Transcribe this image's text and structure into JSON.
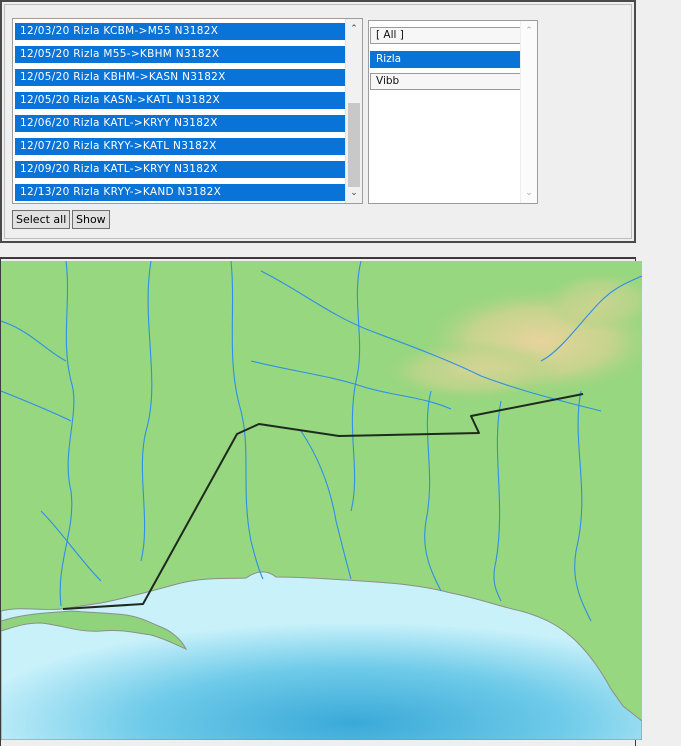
{
  "flights": {
    "rows": [
      "12/03/20 Rizla KCBM->M55 N3182X",
      "12/05/20 Rizla M55->KBHM N3182X",
      "12/05/20 Rizla KBHM->KASN N3182X",
      "12/05/20 Rizla KASN->KATL N3182X",
      "12/06/20 Rizla KATL->KRYY N3182X",
      "12/07/20 Rizla KRYY->KATL N3182X",
      "12/09/20 Rizla KATL->KRYY N3182X",
      "12/13/20 Rizla KRYY->KAND N3182X"
    ],
    "scroll_up_icon": "chevron-up-icon",
    "scroll_down_icon": "chevron-down-icon"
  },
  "users": {
    "items": [
      {
        "label": "[ All ]",
        "selected": false
      },
      {
        "label": "Rizla",
        "selected": true
      },
      {
        "label": "Vibb",
        "selected": false
      }
    ]
  },
  "buttons": {
    "select_all": "Select all",
    "show": "Show"
  },
  "colors": {
    "selection": "#0a73d8",
    "land": "#8fd47c",
    "river": "#2f8fe6",
    "sea_light": "#c8f1fa",
    "sea_deep": "#3aa9d8",
    "route": "#1e2a1e"
  }
}
